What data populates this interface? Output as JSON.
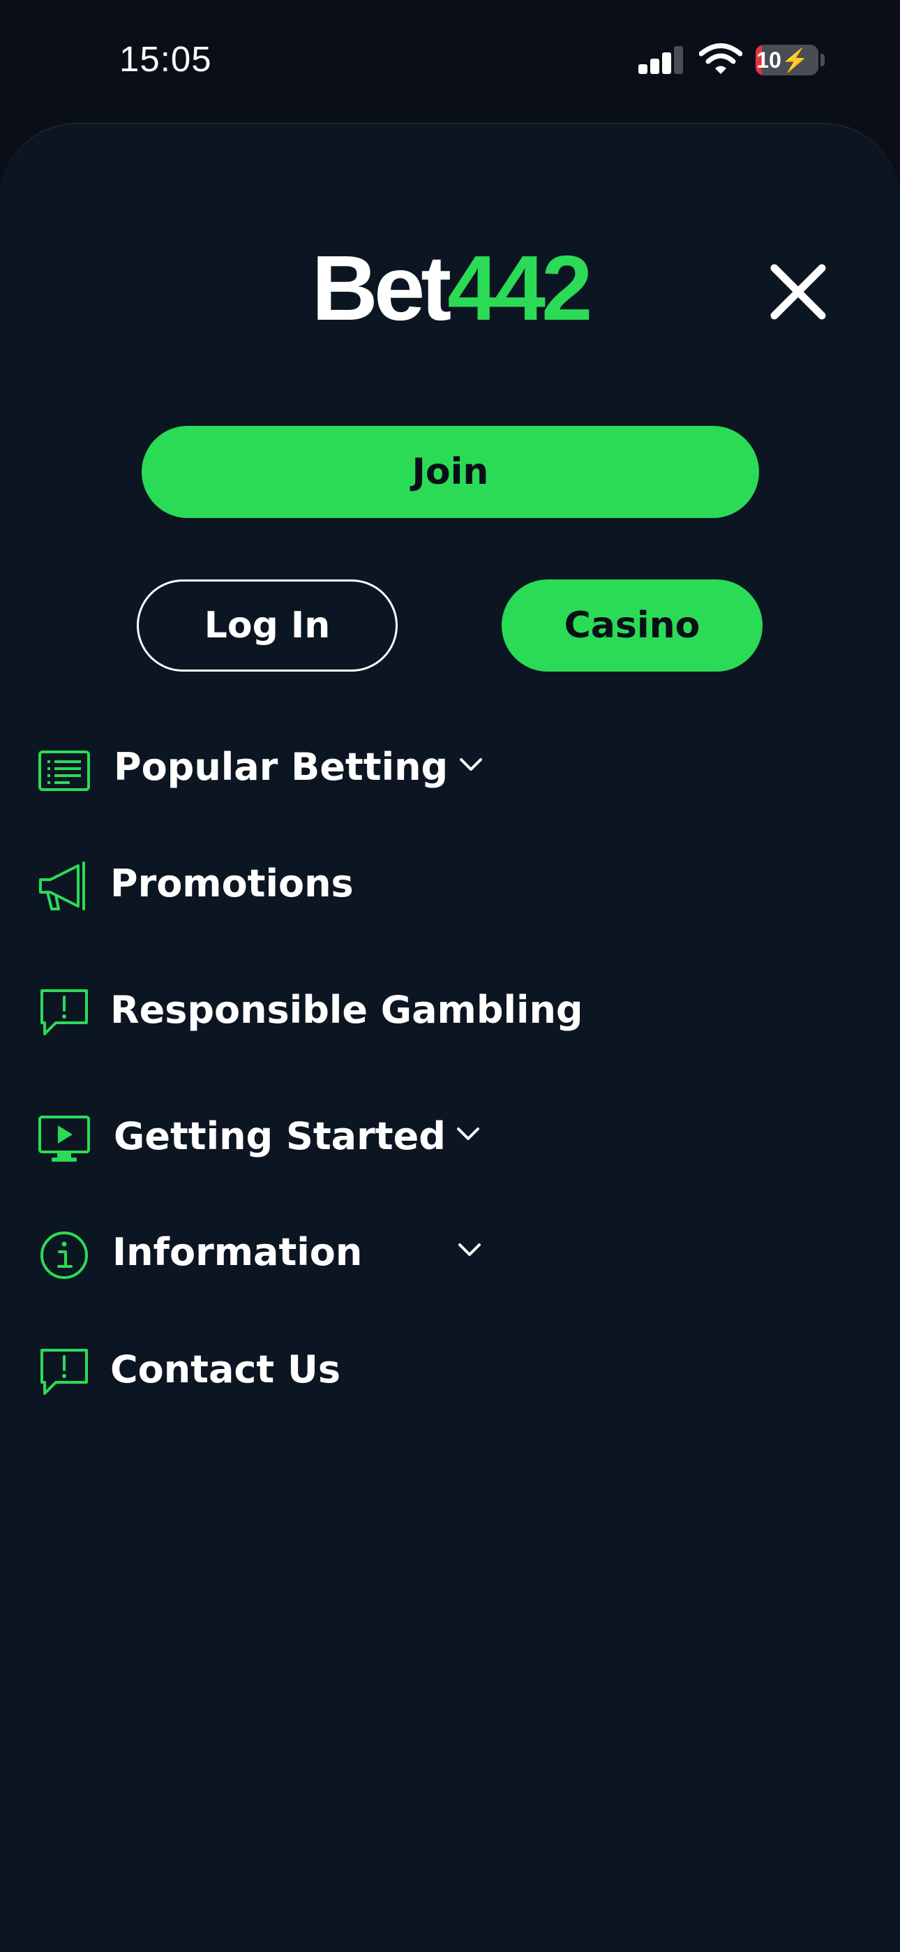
{
  "status_bar": {
    "time": "15:05",
    "battery_level": "10",
    "battery_fraction": 0.1,
    "icons": [
      "signal-icon",
      "wifi-icon",
      "battery-charging-icon"
    ]
  },
  "header": {
    "logo_part1": "Bet",
    "logo_part2": "442",
    "close_icon": "close-icon"
  },
  "actions": {
    "join_label": "Join",
    "login_label": "Log In",
    "casino_label": "Casino"
  },
  "menu": {
    "items": [
      {
        "label": "Popular Betting",
        "icon": "list-icon",
        "expandable": true
      },
      {
        "label": "Promotions",
        "icon": "megaphone-icon",
        "expandable": false
      },
      {
        "label": "Responsible Gambling",
        "icon": "alert-message-icon",
        "expandable": false
      },
      {
        "label": "Getting Started",
        "icon": "video-play-icon",
        "expandable": true
      },
      {
        "label": "Information",
        "icon": "info-icon",
        "expandable": true
      },
      {
        "label": "Contact Us",
        "icon": "alert-message-icon",
        "expandable": false
      }
    ]
  },
  "colors": {
    "background": "#0a0f17",
    "sheet": "#0c1622",
    "accent_green": "#2bdb56",
    "text": "#ffffff",
    "battery_low": "#e5323f"
  }
}
